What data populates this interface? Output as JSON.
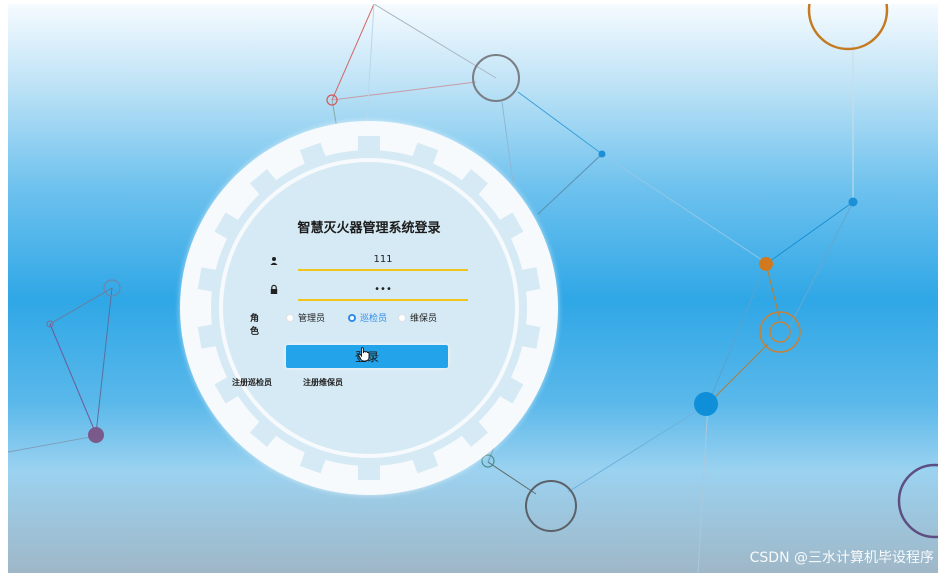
{
  "login": {
    "title": "智慧灭火器管理系统登录",
    "username_value": "111",
    "password_value": "•••",
    "role_label": "角色",
    "roles": [
      "管理员",
      "巡检员",
      "维保员"
    ],
    "selected_role": "巡检员",
    "login_button": "登录",
    "register_links": [
      "注册巡检员",
      "注册维保员"
    ]
  },
  "watermark": "CSDN @三水计算机毕设程序",
  "icons": [
    "user-icon",
    "lock-icon",
    "hand-cursor-icon"
  ],
  "colors": {
    "accent_blue": "#23a3e9",
    "input_underline": "#f2c319",
    "selected_radio": "#2f8be6"
  }
}
